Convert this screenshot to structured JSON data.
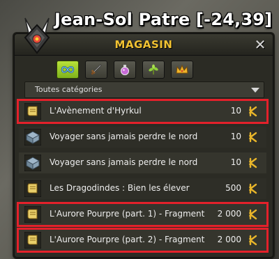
{
  "npc": {
    "title": "Jean-Sol Patre [-24,39]"
  },
  "shop": {
    "title": "MAGASIN",
    "close_icon": "close-icon",
    "tabs": [
      {
        "icon": "infinity-icon",
        "active": true
      },
      {
        "icon": "weapon-icon",
        "active": false
      },
      {
        "icon": "potion-icon",
        "active": false
      },
      {
        "icon": "plant-icon",
        "active": false
      },
      {
        "icon": "crown-icon",
        "active": false
      }
    ],
    "filter": {
      "selected": "Toutes catégories"
    },
    "items": [
      {
        "name": "L'Avènement d'Hyrkul",
        "price": "10",
        "icon": "scroll-icon",
        "highlighted": true
      },
      {
        "name": "Voyager sans jamais perdre le nord",
        "price": "10",
        "icon": "chest-icon",
        "highlighted": false
      },
      {
        "name": "Voyager sans jamais perdre le nord",
        "price": "10",
        "icon": "chest-icon",
        "highlighted": false
      },
      {
        "name": "Les Dragodindes : Bien les élever",
        "price": "500",
        "icon": "scroll-icon",
        "highlighted": false
      },
      {
        "name": "L'Aurore Pourpre (part. 1) - Fragment",
        "price": "2 000",
        "icon": "scroll-icon",
        "highlighted": true
      },
      {
        "name": "L'Aurore Pourpre (part. 2) - Fragment",
        "price": "2 000",
        "icon": "scroll-icon",
        "highlighted": true
      }
    ],
    "currency_icon": "kama-icon",
    "colors": {
      "title": "#f1c232",
      "active_tab": "#9fcc2a",
      "highlight": "#e3212b",
      "currency": "#e8b52a"
    }
  }
}
